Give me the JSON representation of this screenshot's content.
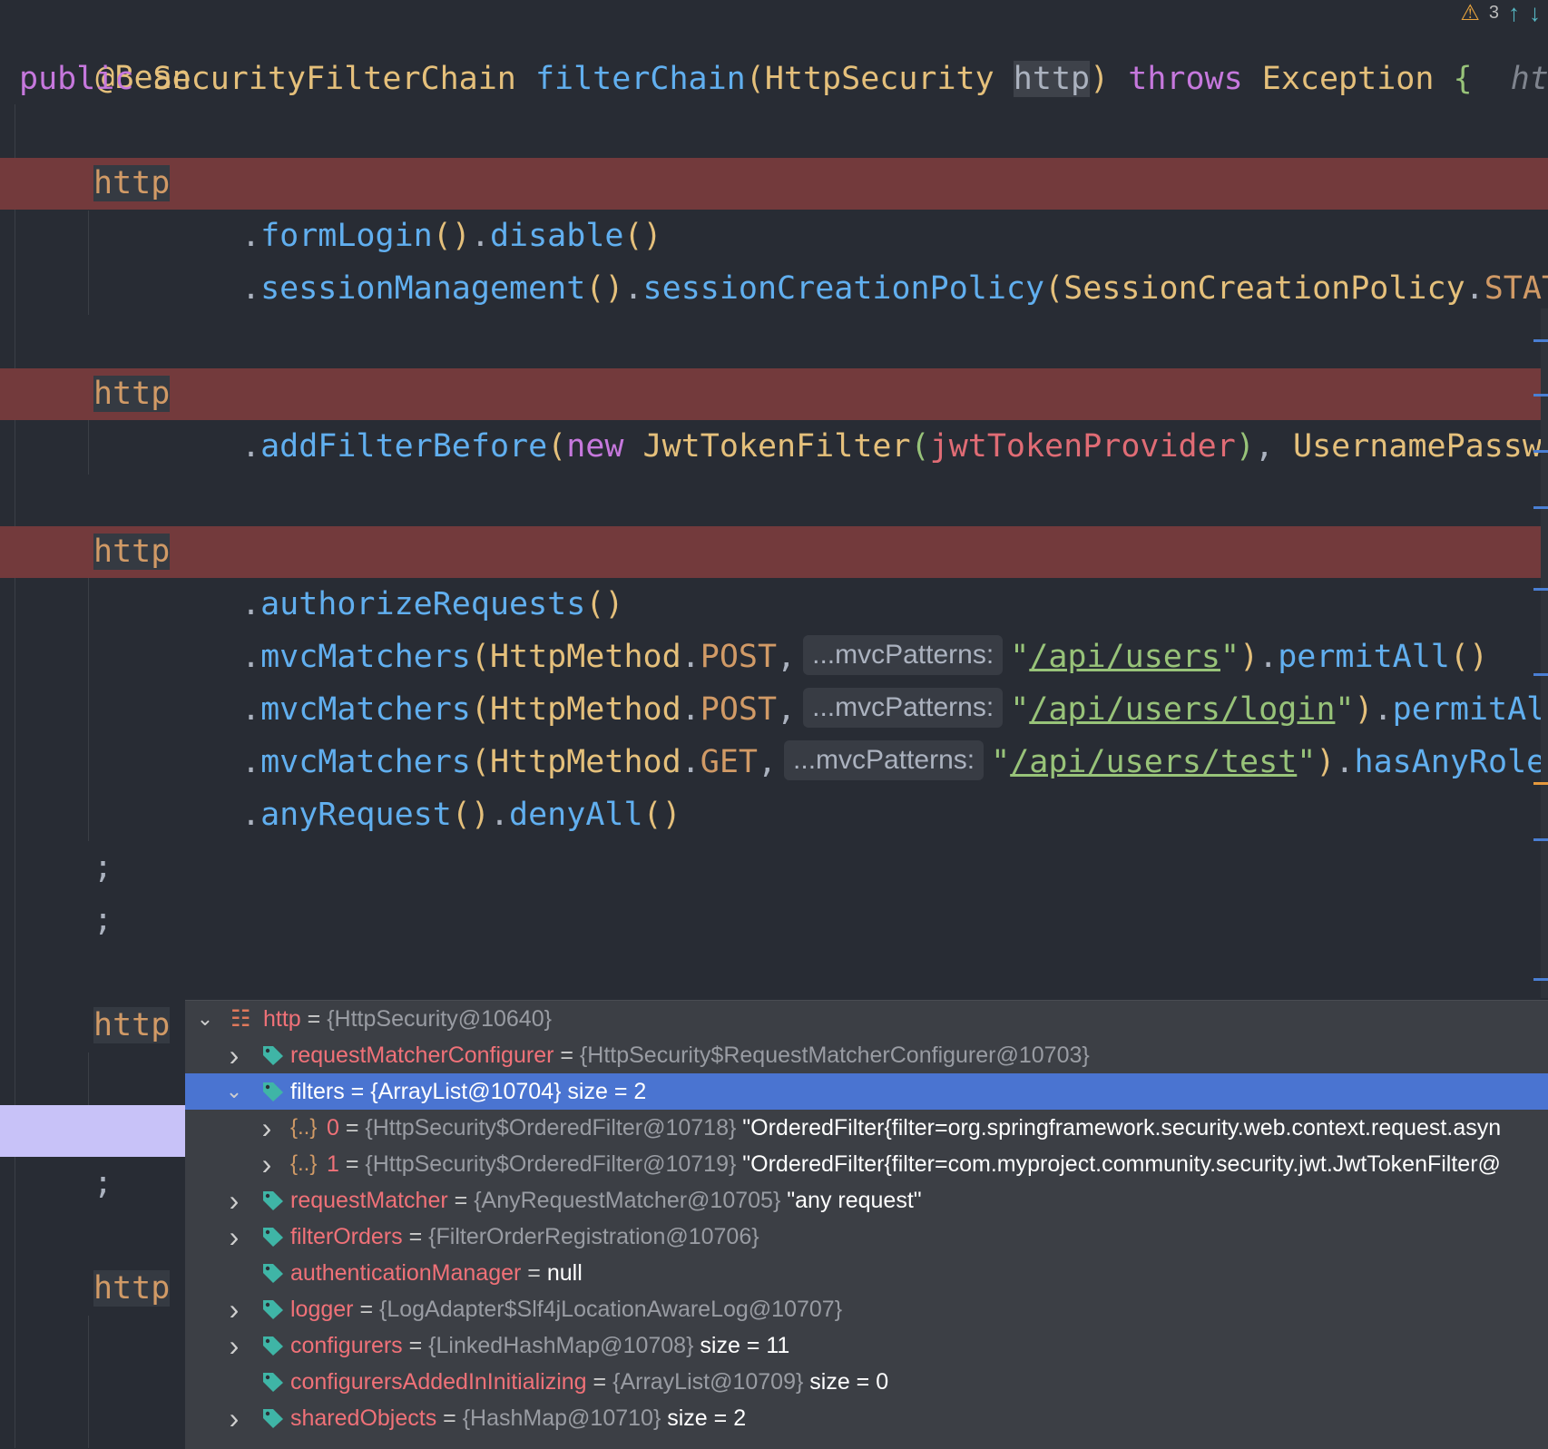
{
  "toolbar": {
    "warning_count": "3",
    "warning_icon": "warning-icon",
    "prev_icon": "arrow-up-icon",
    "next_icon": "arrow-down-icon"
  },
  "code": {
    "annotation": "@Bean",
    "sig_public": "public",
    "sig_type": "SecurityFilterChain",
    "sig_method": "filterChain",
    "sig_paren_open": "(",
    "sig_param_type": "HttpSecurity",
    "sig_param": "http",
    "sig_paren_close": ")",
    "sig_throws": "throws",
    "sig_exception": "Exception",
    "sig_brace": "{",
    "sig_hint": "http",
    "http": "http",
    "l1_dot1": ".",
    "l1_formLogin": "formLogin",
    "l1_p1": "()",
    "l1_dot2": ".",
    "l1_disable": "disable",
    "l1_p2": "()",
    "l2_dot1": ".",
    "l2_session": "sessionManagement",
    "l2_p1": "()",
    "l2_dot2": ".",
    "l2_policy": "sessionCreationPolicy",
    "l2_po": "(",
    "l2_type": "SessionCreationPolicy",
    "l2_dot3": ".",
    "l2_const": "STATEL",
    "l3_dot": ".",
    "l3_add": "addFilterBefore",
    "l3_po": "(",
    "l3_new": "new",
    "l3_type": "JwtTokenFilter",
    "l3_po2": "(",
    "l3_arg": "jwtTokenProvider",
    "l3_pc2": ")",
    "l3_comma": ",",
    "l3_type2": "UsernamePassword",
    "l4_dot": ".",
    "l4_auth": "authorizeRequests",
    "l4_p": "()",
    "m1": {
      "dot": ".",
      "fn": "mvcMatchers",
      "po": "(",
      "type": "HttpMethod",
      "dot2": ".",
      "const": "POST",
      "comma": ",",
      "hint": "...mvcPatterns:",
      "q1": "\"",
      "path": "/api/users",
      "q2": "\"",
      "pc": ")",
      "dot3": ".",
      "tail": "permitAll",
      "tailp": "()"
    },
    "m2": {
      "dot": ".",
      "fn": "mvcMatchers",
      "po": "(",
      "type": "HttpMethod",
      "dot2": ".",
      "const": "POST",
      "comma": ",",
      "hint": "...mvcPatterns:",
      "q1": "\"",
      "path": "/api/users/login",
      "q2": "\"",
      "pc": ")",
      "dot3": ".",
      "tail": "permitAl",
      "tailp": ""
    },
    "m3": {
      "dot": ".",
      "fn": "mvcMatchers",
      "po": "(",
      "type": "HttpMethod",
      "dot2": ".",
      "const": "GET",
      "comma": ",",
      "hint": "...mvcPatterns:",
      "q1": "\"",
      "path": "/api/users/test",
      "q2": "\"",
      "pc": ")",
      "dot3": ".",
      "tail": "hasAnyRole",
      "tailp": ""
    },
    "l5_dot1": ".",
    "l5_any": "anyRequest",
    "l5_p1": "()",
    "l5_dot2": ".",
    "l5_deny": "denyAll",
    "l5_p2": "()",
    "semi": ";"
  },
  "debugger": {
    "root": {
      "name": "http",
      "eq": " = ",
      "type": "{HttpSecurity@10640}",
      "icon": "watch-icon"
    },
    "rows": [
      {
        "name": "requestMatcherConfigurer",
        "eq": " = ",
        "type": "{HttpSecurity$RequestMatcherConfigurer@10703}",
        "value": ""
      },
      {
        "name": "filters",
        "eq": " = ",
        "type": "{ArrayList@10704}",
        "value": "  size = 2"
      },
      {
        "name": "0",
        "eq": " = ",
        "type": "{HttpSecurity$OrderedFilter@10718}",
        "value": " \"OrderedFilter{filter=org.springframework.security.web.context.request.asyn"
      },
      {
        "name": "1",
        "eq": " = ",
        "type": "{HttpSecurity$OrderedFilter@10719}",
        "value": " \"OrderedFilter{filter=com.myproject.community.security.jwt.JwtTokenFilter@"
      },
      {
        "name": "requestMatcher",
        "eq": " = ",
        "type": "{AnyRequestMatcher@10705}",
        "value": " \"any request\""
      },
      {
        "name": "filterOrders",
        "eq": " = ",
        "type": "{FilterOrderRegistration@10706}",
        "value": ""
      },
      {
        "name": "authenticationManager",
        "eq": " = ",
        "type": "",
        "value": "null"
      },
      {
        "name": "logger",
        "eq": " = ",
        "type": "{LogAdapter$Slf4jLocationAwareLog@10707}",
        "value": ""
      },
      {
        "name": "configurers",
        "eq": " = ",
        "type": "{LinkedHashMap@10708}",
        "value": "  size = 11"
      },
      {
        "name": "configurersAddedInInitializing",
        "eq": " = ",
        "type": "{ArrayList@10709}",
        "value": "  size = 0"
      },
      {
        "name": "sharedObjects",
        "eq": " = ",
        "type": "{HashMap@10710}",
        "value": "  size = 2"
      }
    ],
    "brace_label": "{..}"
  },
  "colors": {
    "breakpoint_band": "#733a3c",
    "selection": "#4a74d1",
    "background": "#282c34"
  }
}
